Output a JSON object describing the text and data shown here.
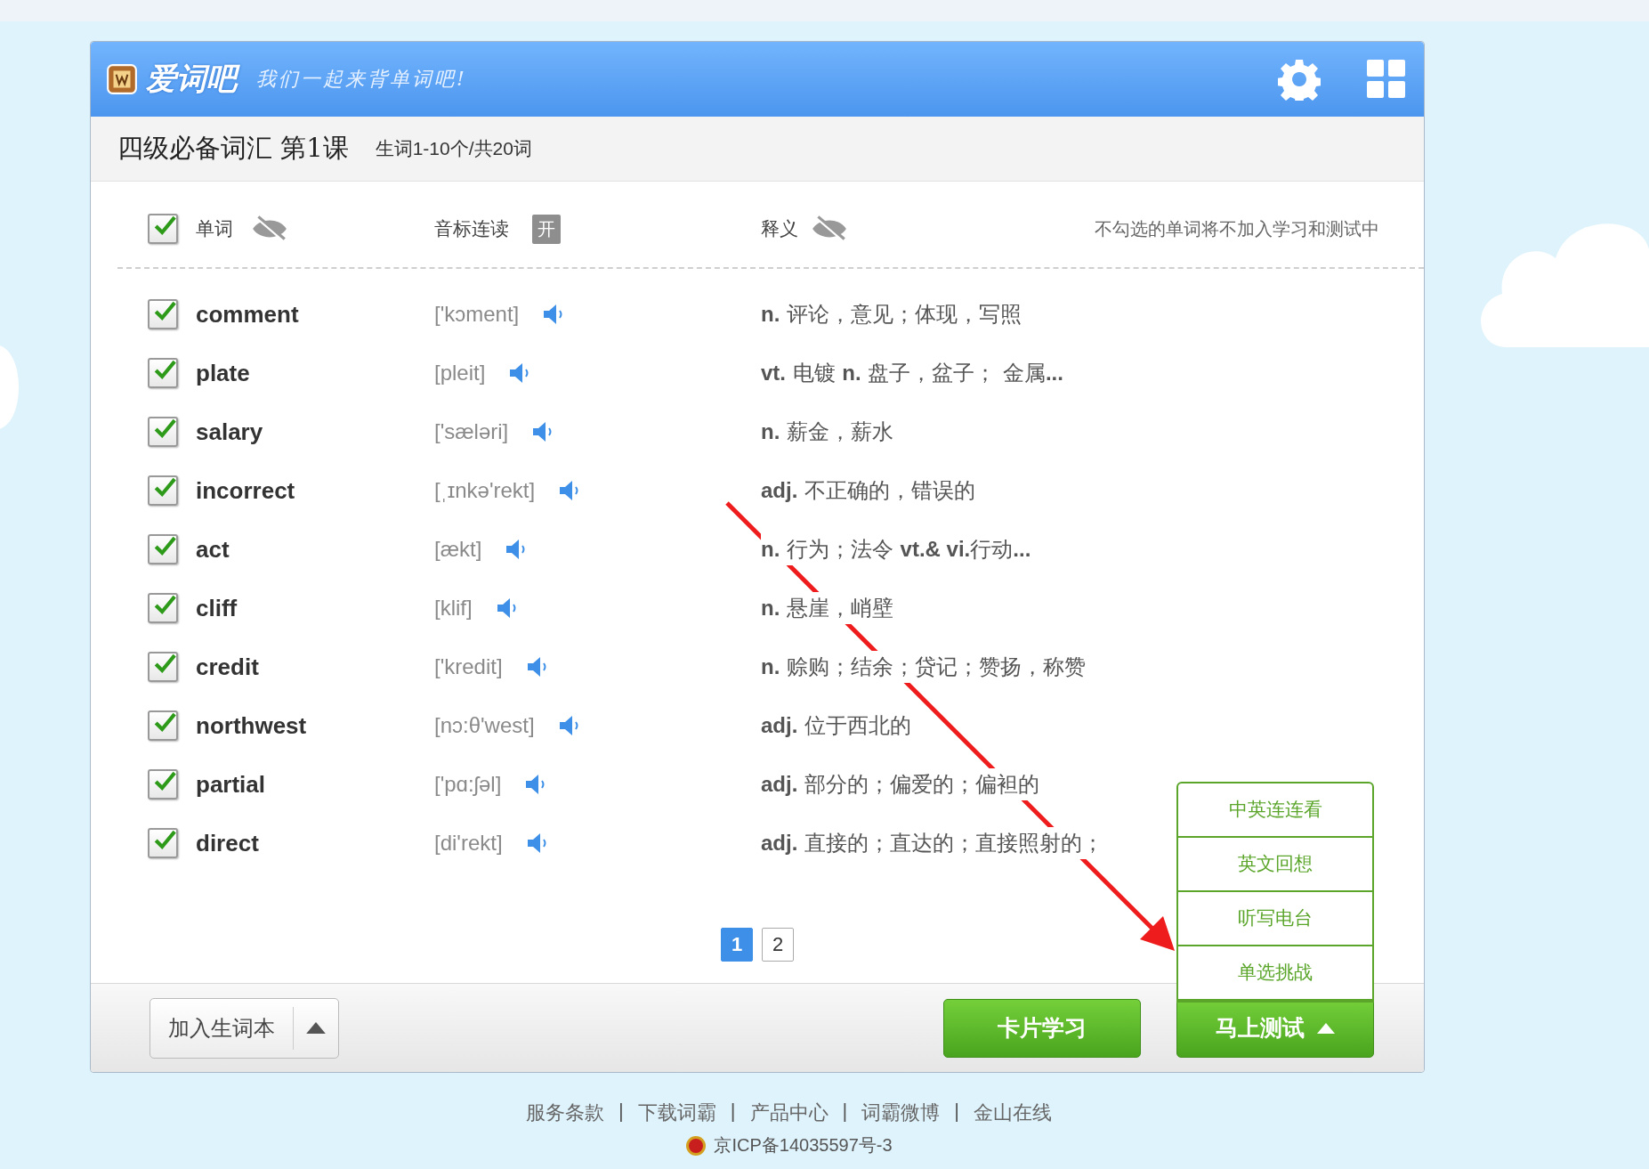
{
  "header": {
    "logo_text": "爱词吧",
    "slogan": "我们一起来背单词吧!"
  },
  "lesson": {
    "title": "四级必备词汇 第1课",
    "subtitle": "生词1-10个/共20词"
  },
  "columns": {
    "select_all_checked": true,
    "word_label": "单词",
    "phonetic_label": "音标连读",
    "toggle": "开",
    "meaning_label": "释义",
    "note": "不勾选的单词将不加入学习和测试中"
  },
  "words": [
    {
      "word": "comment",
      "phonetic": "['kɔment]",
      "meaning": "**n.** 评论，意见；体现，写照",
      "checked": true
    },
    {
      "word": "plate",
      "phonetic": "[pleit]",
      "meaning": "**vt.** 电镀 **n.** 盘子，盆子； 金属**...**",
      "checked": true
    },
    {
      "word": "salary",
      "phonetic": "['sæləri]",
      "meaning": "**n.** 薪金，薪水",
      "checked": true
    },
    {
      "word": "incorrect",
      "phonetic": "[ˌɪnkə'rekt]",
      "meaning": "**adj.** 不正确的，错误的",
      "checked": true
    },
    {
      "word": "act",
      "phonetic": "[ækt]",
      "meaning": "**n.** 行为；法令 **vt.& vi.**行动**...**",
      "checked": true
    },
    {
      "word": "cliff",
      "phonetic": "[klif]",
      "meaning": "**n.** 悬崖，峭壁",
      "checked": true
    },
    {
      "word": "credit",
      "phonetic": "['kredit]",
      "meaning": "**n.** 赊购；结余；贷记；赞扬，称赞",
      "checked": true
    },
    {
      "word": "northwest",
      "phonetic": "[nɔ:θ'west]",
      "meaning": "**adj.** 位于西北的",
      "checked": true
    },
    {
      "word": "partial",
      "phonetic": "['pɑ:ʃəl]",
      "meaning": "**adj.** 部分的；偏爱的；偏袒的",
      "checked": true
    },
    {
      "word": "direct",
      "phonetic": "[di'rekt]",
      "meaning": "**adj.** 直接的；直达的；直接照射的；",
      "checked": true
    }
  ],
  "pagination": [
    {
      "label": "1",
      "selected": true
    },
    {
      "label": "2",
      "selected": false
    }
  ],
  "bottom_bar": {
    "add_button": "加入生词本",
    "card_button": "卡片学习",
    "test_button": "马上测试",
    "test_menu": {
      "expanded": true,
      "items": [
        "中英连连看",
        "英文回想",
        "听写电台",
        "单选挑战"
      ]
    }
  },
  "footer": {
    "separator": "|",
    "links": [
      "服务条款",
      "下载词霸",
      "产品中心",
      "词霸微博",
      "金山在线"
    ],
    "icp": "京ICP备14035597号-3"
  }
}
